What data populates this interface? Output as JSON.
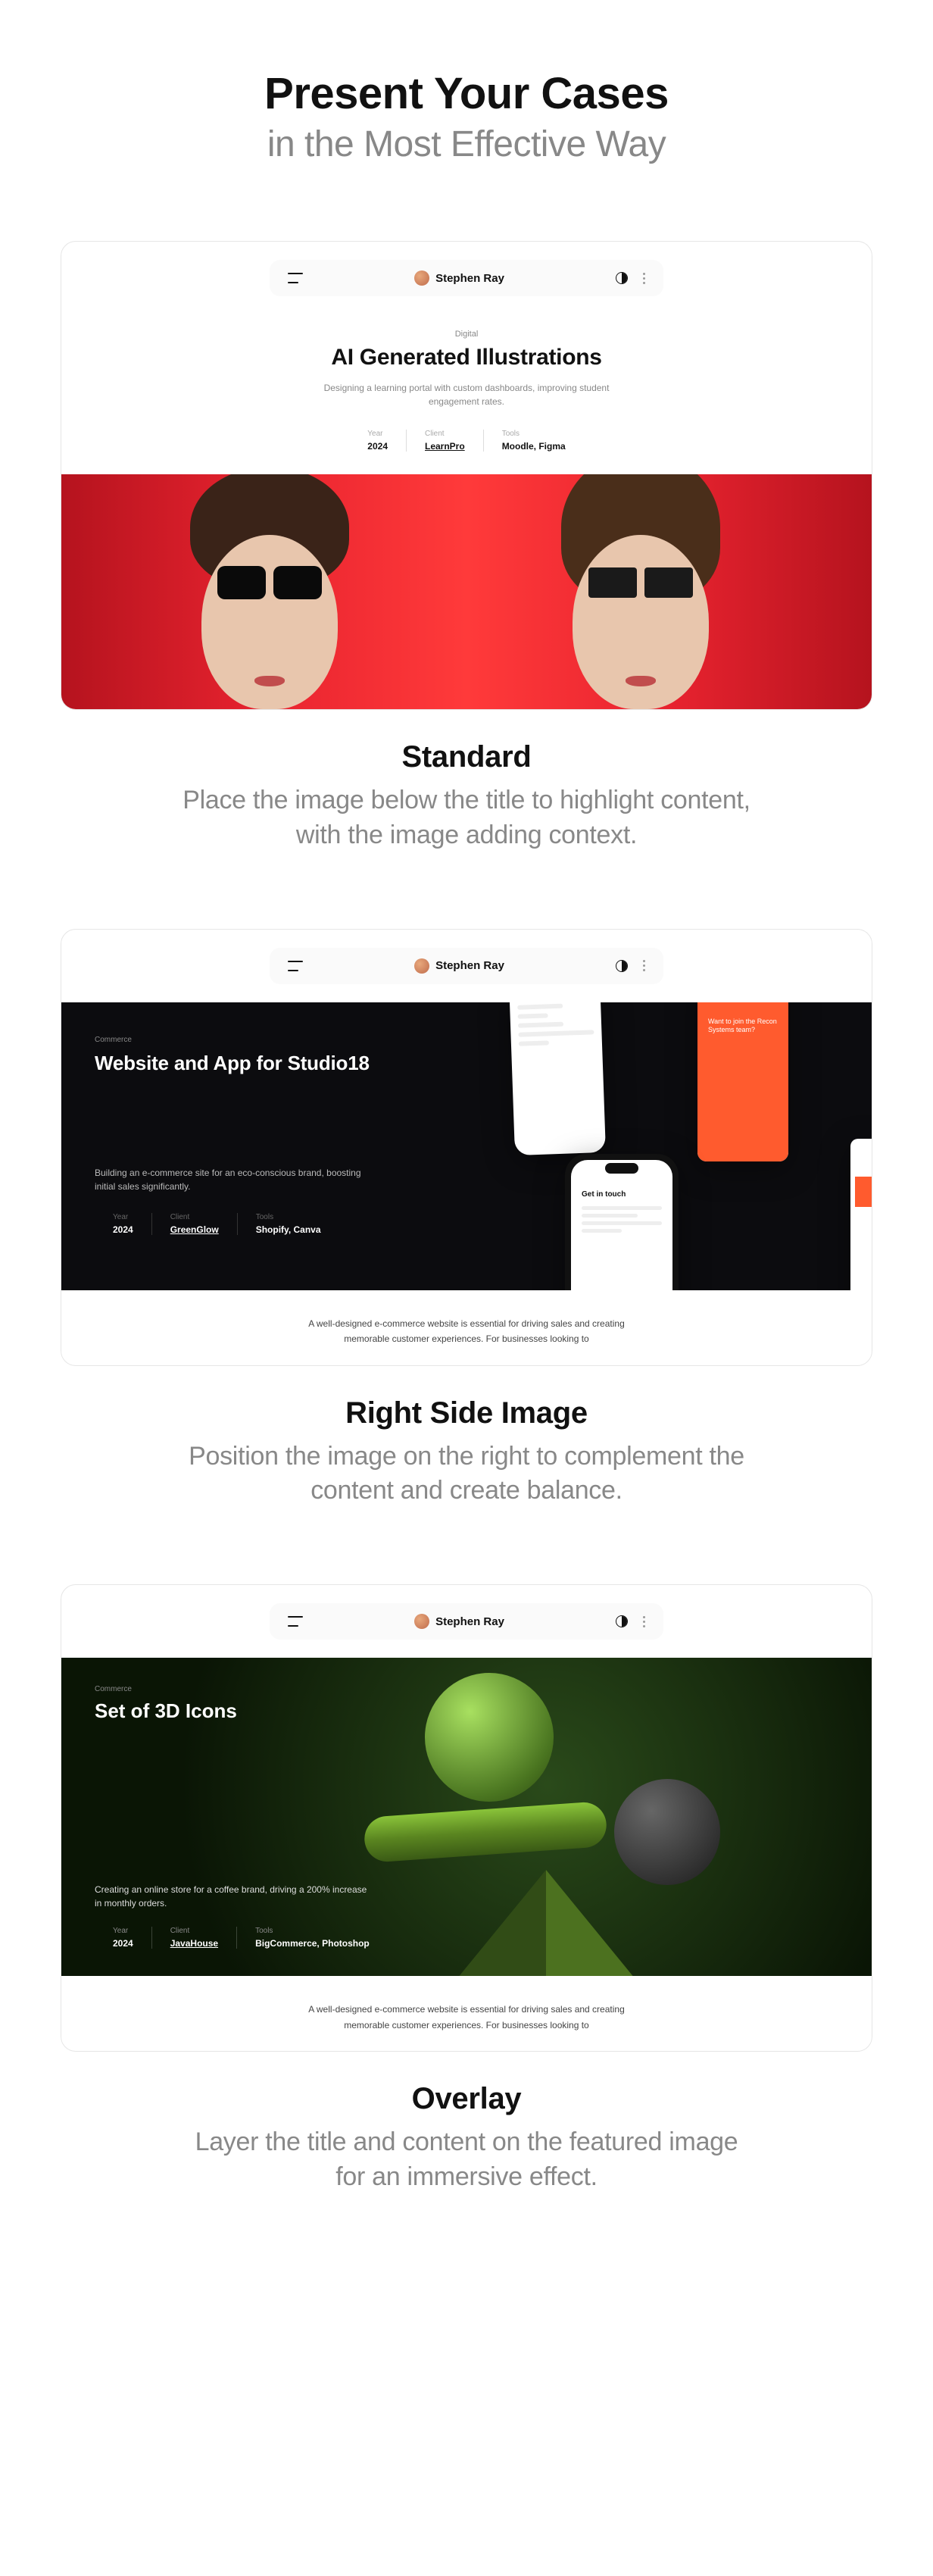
{
  "hero": {
    "title": "Present Your Cases",
    "subtitle": "in the Most Effective Way"
  },
  "author": "Stephen Ray",
  "case1": {
    "eyebrow": "Digital",
    "title": "AI Generated Illustrations",
    "desc": "Designing a learning portal with custom dashboards, improving student engagement rates.",
    "meta": {
      "year_l": "Year",
      "year": "2024",
      "client_l": "Client",
      "client": "LearnPro",
      "tools_l": "Tools",
      "tools": "Moodle, Figma"
    }
  },
  "sec1": {
    "title": "Standard",
    "desc": "Place the image below the title to highlight content, with the image adding context."
  },
  "case2": {
    "eyebrow": "Commerce",
    "title": "Website and App for Studio18",
    "desc": "Building an e-commerce site for an eco-conscious brand, boosting initial sales significantly.",
    "meta": {
      "year_l": "Year",
      "year": "2024",
      "client_l": "Client",
      "client": "GreenGlow",
      "tools_l": "Tools",
      "tools": "Shopify, Canva"
    },
    "preview": "A well-designed e-commerce website is essential for driving sales and creating memorable customer experiences. For businesses looking to"
  },
  "sec2": {
    "title": "Right Side Image",
    "desc": "Position the image on the right to complement the content and create balance."
  },
  "case3": {
    "eyebrow": "Commerce",
    "title": "Set of 3D Icons",
    "desc": "Creating an online store for a coffee brand, driving a 200% increase in monthly orders.",
    "meta": {
      "year_l": "Year",
      "year": "2024",
      "client_l": "Client",
      "client": "JavaHouse",
      "tools_l": "Tools",
      "tools": "BigCommerce, Photoshop"
    },
    "preview": "A well-designed e-commerce website is essential for driving sales and creating memorable customer experiences. For businesses looking to"
  },
  "sec3": {
    "title": "Overlay",
    "desc": "Layer the title and content on the featured image for an immersive effect."
  },
  "phone_b_text": "Want to join the Recon Systems team?",
  "phone_c_title": "Get in touch"
}
